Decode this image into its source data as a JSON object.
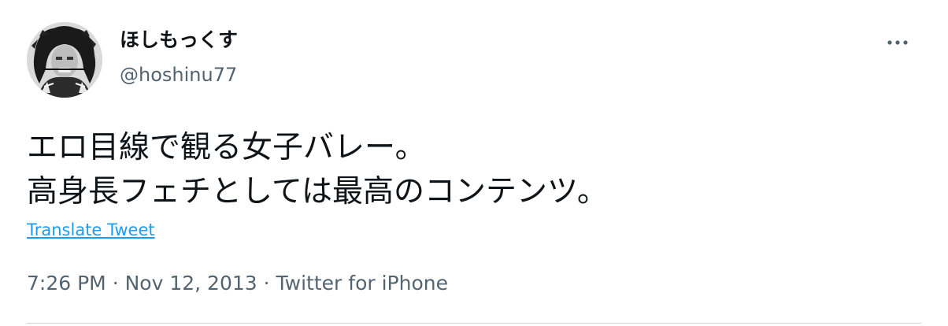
{
  "user": {
    "display_name": "ほしもっくす",
    "handle": "@hoshinu77",
    "avatar_icon": "avatar-photo"
  },
  "tweet": {
    "lines": [
      "エロ目線で観る女子バレー。",
      "高身長フェチとしては最高のコンテンツ。"
    ],
    "translate_label": "Translate Tweet",
    "time": "7:26 PM",
    "separator": "·",
    "date": "Nov 12, 2013",
    "source": "Twitter for iPhone"
  },
  "icons": {
    "more": "more-dots-icon"
  },
  "colors": {
    "text_primary": "#0f1419",
    "text_secondary": "#536471",
    "link": "#1d9bf0",
    "divider": "#cfd9de"
  }
}
